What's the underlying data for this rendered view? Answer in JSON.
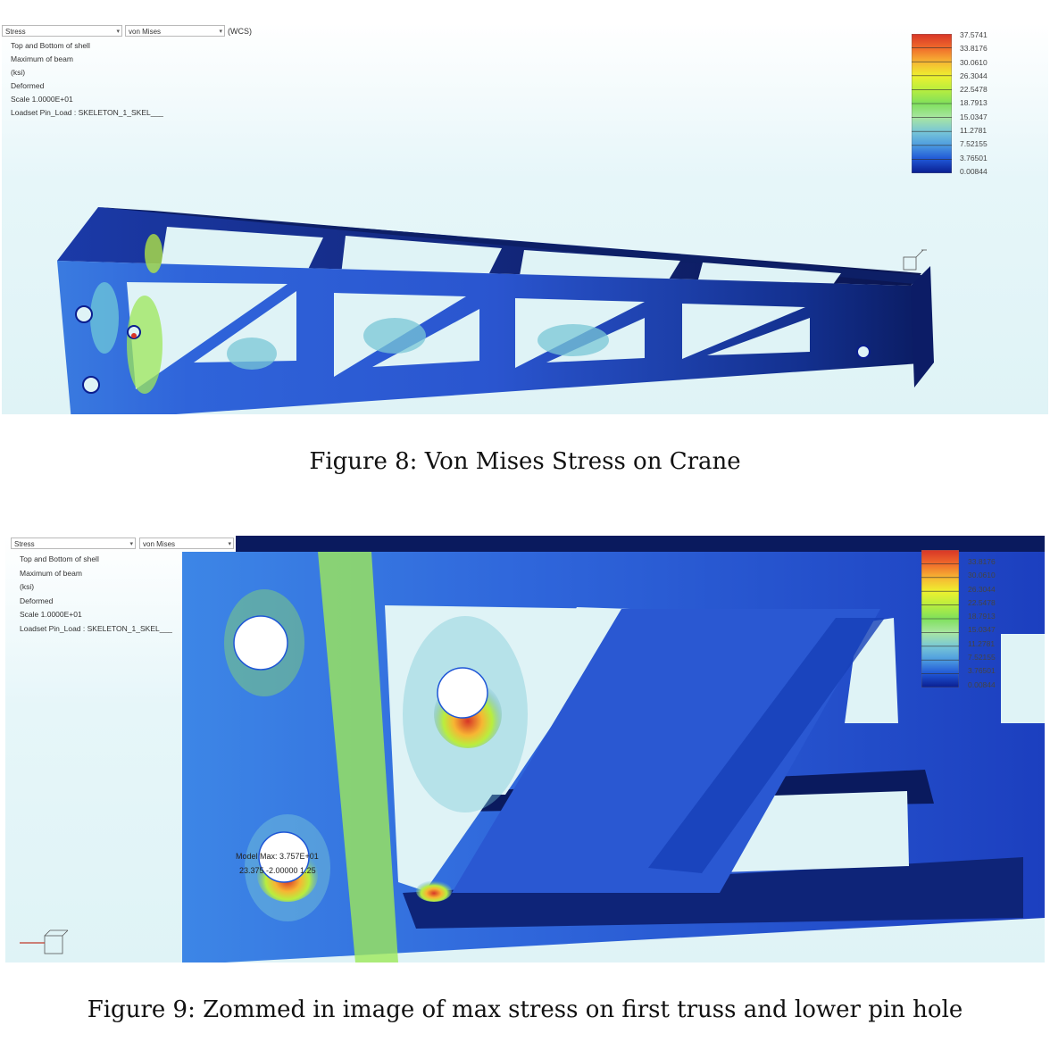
{
  "figure8": {
    "toolbar": {
      "result_type": "Stress",
      "component": "von Mises",
      "coord_system": "(WCS)"
    },
    "info_lines": [
      "Top and Bottom of shell",
      "Maximum of beam",
      "(ksi)",
      "Deformed",
      "Scale  1.0000E+01",
      "Loadset Pin_Load :   SKELETON_1_SKEL___"
    ],
    "legend": {
      "values": [
        "37.5741",
        "33.8176",
        "30.0610",
        "26.3044",
        "22.5478",
        "18.7913",
        "15.0347",
        "11.2781",
        "7.52155",
        "3.76501",
        "0.00844"
      ],
      "colors": [
        "#d73527",
        "#f06a2b",
        "#f7b533",
        "#eef02f",
        "#b9ee3e",
        "#7fe05c",
        "#a9e6a1",
        "#79c7d6",
        "#4c9be0",
        "#1f56d6",
        "#0a1d8f"
      ]
    },
    "caption": "Figure 8:  Von Mises Stress on Crane"
  },
  "figure9": {
    "toolbar": {
      "result_type": "Stress",
      "component": "von Mises"
    },
    "info_lines": [
      "Top and Bottom of shell",
      "Maximum of beam",
      "(ksi)",
      "Deformed",
      "Scale  1.0000E+01",
      "Loadset Pin_Load :   SKELETON_1_SKEL___"
    ],
    "legend": {
      "values": [
        "33.8176",
        "30.0610",
        "26.3044",
        "22.5478",
        "18.7913",
        "15.0347",
        "11.2781",
        "7.52155",
        "3.76501",
        "0.00844"
      ]
    },
    "model_max_label": "Model Max:  3.757E+01",
    "model_max_coords": "23.375  -2.00000  1.25",
    "caption": "Figure 9:  Zommed in image of max stress on first truss and lower pin hole"
  }
}
